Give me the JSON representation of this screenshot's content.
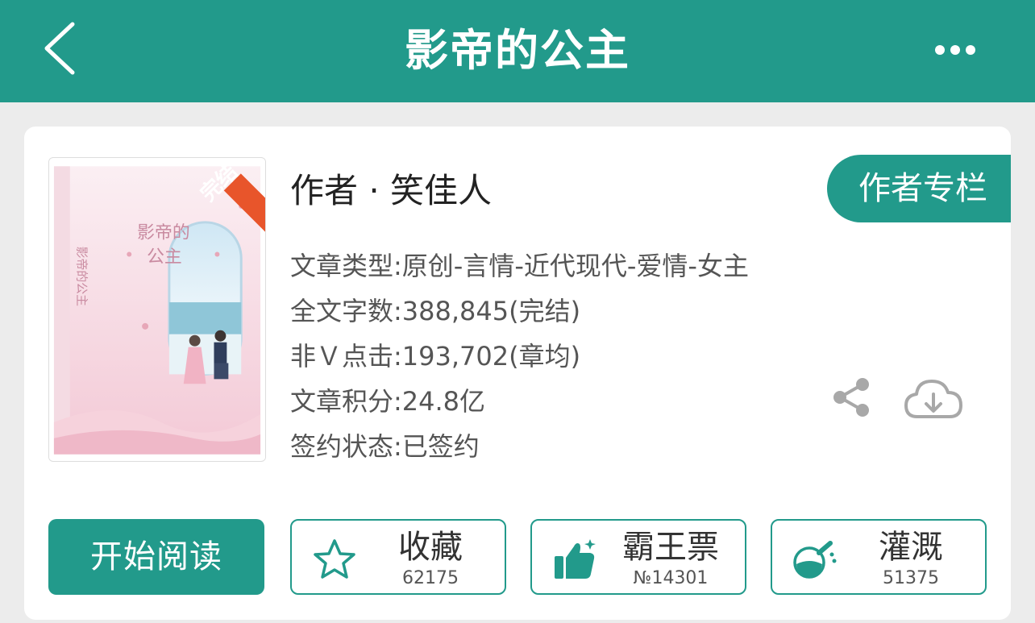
{
  "header": {
    "title": "影帝的公主",
    "back_icon": "chevron-left-icon",
    "more_icon": "more-dots-icon"
  },
  "book": {
    "cover_badge": "完结",
    "cover_title_line1": "影帝的",
    "cover_title_line2": "公主",
    "cover_side_title": "影帝的公主",
    "author_line": "作者 · 笑佳人",
    "author_column_label": "作者专栏",
    "meta": [
      "文章类型:原创-言情-近代现代-爱情-女主",
      "全文字数:388,845(完结)",
      "非Ｖ点击:193,702(章均)",
      "文章积分:24.8亿",
      "签约状态:已签约"
    ]
  },
  "actions": {
    "read_label": "开始阅读",
    "favorite": {
      "label": "收藏",
      "count": "62175",
      "icon": "star-outline-icon"
    },
    "vote": {
      "label": "霸王票",
      "count": "№14301",
      "icon": "thumbs-up-icon"
    },
    "nourish": {
      "label": "灌溉",
      "count": "51375",
      "icon": "flask-icon"
    }
  },
  "colors": {
    "accent": "#229a8b",
    "background": "#ececec",
    "badge": "#e8552b"
  }
}
